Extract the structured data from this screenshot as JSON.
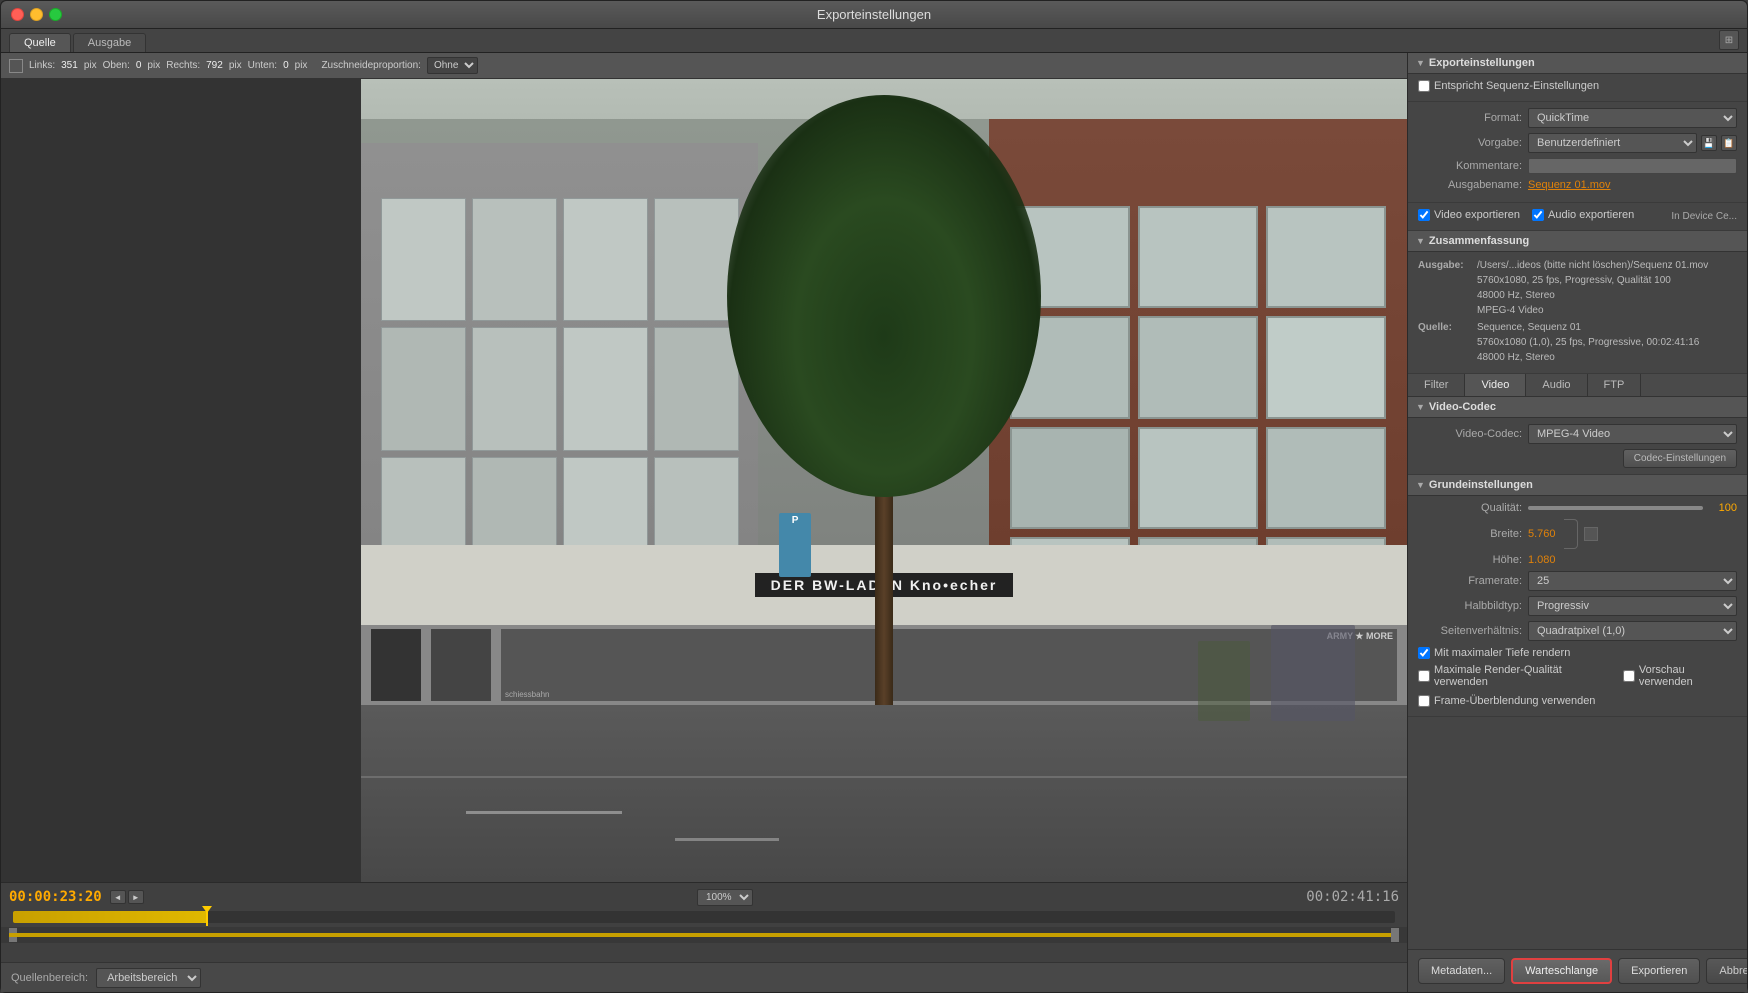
{
  "window": {
    "title": "Exporteinstellungen"
  },
  "tabs": {
    "items": [
      "Quelle",
      "Ausgabe"
    ],
    "active": 0
  },
  "crop_toolbar": {
    "links_label": "Links:",
    "links_value": "351",
    "pix1": "pix",
    "oben_label": "Oben:",
    "oben_value": "0",
    "pix2": "pix",
    "rechts_label": "Rechts:",
    "rechts_value": "792",
    "pix3": "pix",
    "unten_label": "Unten:",
    "unten_value": "0",
    "pix4": "pix",
    "zuschneide_label": "Zuschneideproportion:",
    "zuschneide_value": "Ohne"
  },
  "timecodes": {
    "current": "00:00:23:20",
    "total": "00:02:41:16"
  },
  "zoom": {
    "value": "100%"
  },
  "bottom_bar": {
    "quellenbereich_label": "Quellenbereich:",
    "quellenbereich_value": "Arbeitsbereich"
  },
  "export_settings": {
    "section_title": "Exporteinstellungen",
    "entspricht_label": "Entspricht Sequenz-Einstellungen",
    "format_label": "Format:",
    "format_value": "QuickTime",
    "vorgabe_label": "Vorgabe:",
    "vorgabe_value": "Benutzerdefiniert",
    "kommentare_label": "Kommentare:",
    "kommentare_value": "",
    "ausgabename_label": "Ausgabename:",
    "ausgabename_value": "Sequenz 01.mov",
    "video_export_label": "Video exportieren",
    "audio_export_label": "Audio exportieren",
    "device_ce_label": "In Device Ce..."
  },
  "zusammenfassung": {
    "title": "Zusammenfassung",
    "ausgabe_label": "Ausgabe:",
    "ausgabe_value": "/Users/...ideos (bitte nicht löschen)/Sequenz 01.mov\n5760x1080, 25 fps, Progressiv, Qualität 100\n48000 Hz, Stereo\nMPEG-4 Video",
    "quelle_label": "Quelle:",
    "quelle_value": "Sequence, Sequenz 01\n5760x1080 (1,0), 25 fps, Progressive, 00:02:41:16\n48000 Hz, Stereo"
  },
  "inner_tabs": {
    "items": [
      "Filter",
      "Video",
      "Audio",
      "FTP"
    ],
    "active": 1
  },
  "video_codec": {
    "section_title": "Video-Codec",
    "codec_label": "Video-Codec:",
    "codec_value": "MPEG-4 Video",
    "einstellungen_label": "Codec-Einstellungen"
  },
  "grundeinstellungen": {
    "section_title": "Grundeinstellungen",
    "qualitaet_label": "Qualität:",
    "qualitaet_value": "100",
    "breite_label": "Breite:",
    "breite_value": "5.760",
    "hoehe_label": "Höhe:",
    "hoehe_value": "1.080",
    "framerate_label": "Framerate:",
    "framerate_value": "25",
    "halbbild_label": "Halbbildtyp:",
    "halbbild_value": "Progressiv",
    "seitenverhaeltnis_label": "Seitenverhältnis:",
    "seitenverhaeltnis_value": "Quadratpixel (1,0)",
    "max_tiefe_label": "Mit maximaler Tiefe rendern",
    "max_render_label": "Maximale Render-Qualität verwenden",
    "vorschau_label": "Vorschau verwenden",
    "frame_blend_label": "Frame-Überblendung verwenden"
  },
  "buttons": {
    "metadaten": "Metadaten...",
    "warteschlange": "Warteschlange",
    "exportieren": "Exportieren",
    "abbrechen": "Abbrechen"
  }
}
